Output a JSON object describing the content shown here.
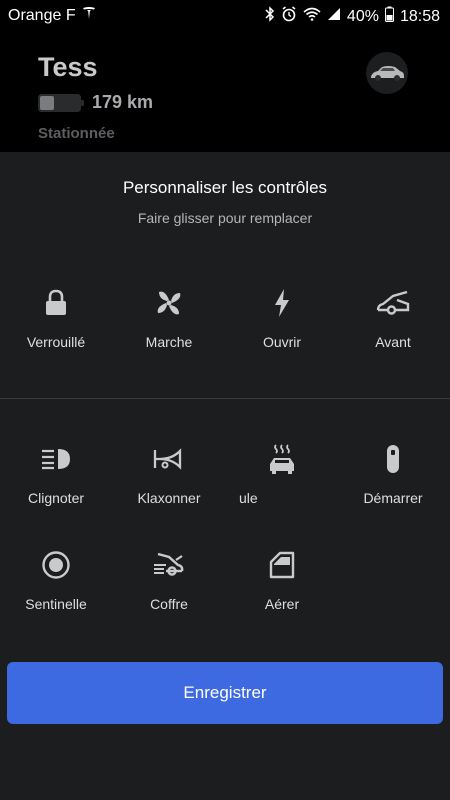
{
  "status_bar": {
    "carrier": "Orange F",
    "battery_percent": "40%",
    "time": "18:58"
  },
  "vehicle": {
    "name": "Tess",
    "range": "179 km",
    "state": "Stationnée",
    "battery_level": 0.35
  },
  "sheet": {
    "title": "Personnaliser les contrôles",
    "subtitle": "Faire glisser pour remplacer"
  },
  "active_controls": [
    {
      "label": "Verrouillé",
      "icon": "lock-icon"
    },
    {
      "label": "Marche",
      "icon": "fan-icon"
    },
    {
      "label": "Ouvrir",
      "icon": "lightning-icon"
    },
    {
      "label": "Avant",
      "icon": "frunk-icon"
    }
  ],
  "available_controls": [
    {
      "label": "Clignoter",
      "icon": "headlights-icon"
    },
    {
      "label": "Klaxonner",
      "icon": "horn-icon"
    },
    {
      "label": "ule",
      "icon": "car-heat-icon"
    },
    {
      "label": "Démarrer",
      "icon": "key-fob-icon"
    },
    {
      "label": "Sentinelle",
      "icon": "sentry-icon"
    },
    {
      "label": "Coffre",
      "icon": "trunk-icon"
    },
    {
      "label": "Aérer",
      "icon": "window-vent-icon"
    }
  ],
  "save_button": {
    "label": "Enregistrer"
  },
  "colors": {
    "accent": "#3e6ae1",
    "background": "#1c1d1f",
    "header": "#000000"
  }
}
